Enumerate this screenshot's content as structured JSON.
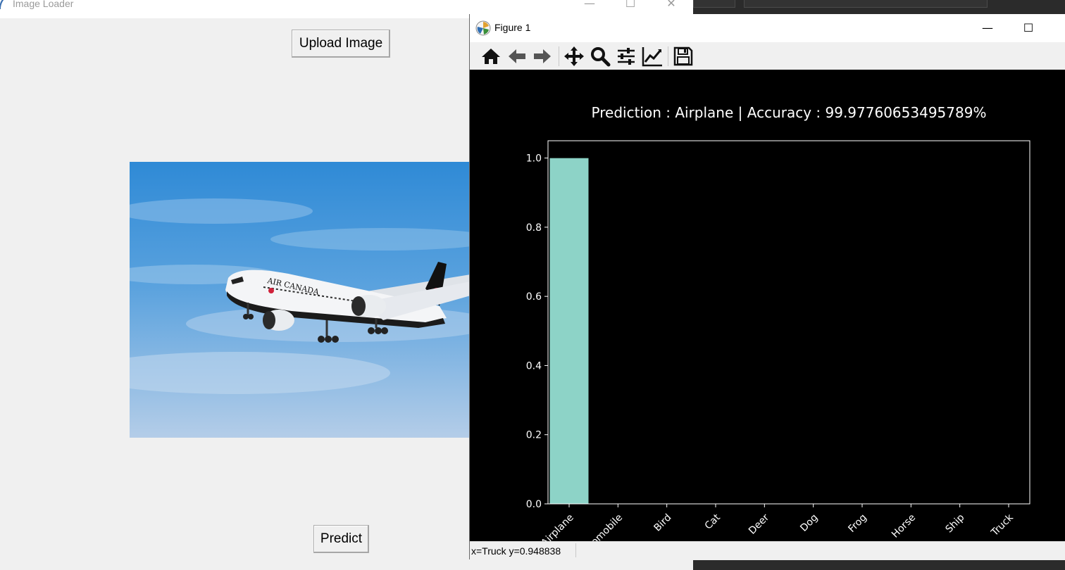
{
  "image_loader": {
    "title": "Image Loader",
    "upload_label": "Upload Image",
    "predict_label": "Predict",
    "controls": {
      "minimize": "—",
      "maximize": "☐",
      "close": "✕"
    }
  },
  "figure": {
    "title": "Figure 1",
    "controls": {
      "minimize": "—",
      "maximize": "☐"
    },
    "toolbar": [
      "home-icon",
      "back-icon",
      "forward-icon",
      "pan-icon",
      "zoom-icon",
      "configure-subplots-icon",
      "edit-axis-icon",
      "save-icon"
    ],
    "status": "x=Truck y=0.948838"
  },
  "colors": {
    "bar": "#8dd3c7",
    "chart_bg": "#000000",
    "chart_fg": "#ffffff",
    "window_bg": "#f0f0f0"
  },
  "chart_data": {
    "type": "bar",
    "title": "Prediction : Airplane | Accuracy : 99.97760653495789%",
    "xlabel": "",
    "ylabel": "",
    "categories": [
      "Airplane",
      "Automobile",
      "Bird",
      "Cat",
      "Deer",
      "Dog",
      "Frog",
      "Horse",
      "Ship",
      "Truck"
    ],
    "values": [
      0.9998,
      0,
      0,
      0,
      0,
      0,
      0,
      0,
      0,
      0
    ],
    "ylim": [
      0,
      1.05
    ],
    "yticks": [
      "0.0",
      "0.2",
      "0.4",
      "0.6",
      "0.8",
      "1.0"
    ],
    "grid": false,
    "legend": "none"
  }
}
